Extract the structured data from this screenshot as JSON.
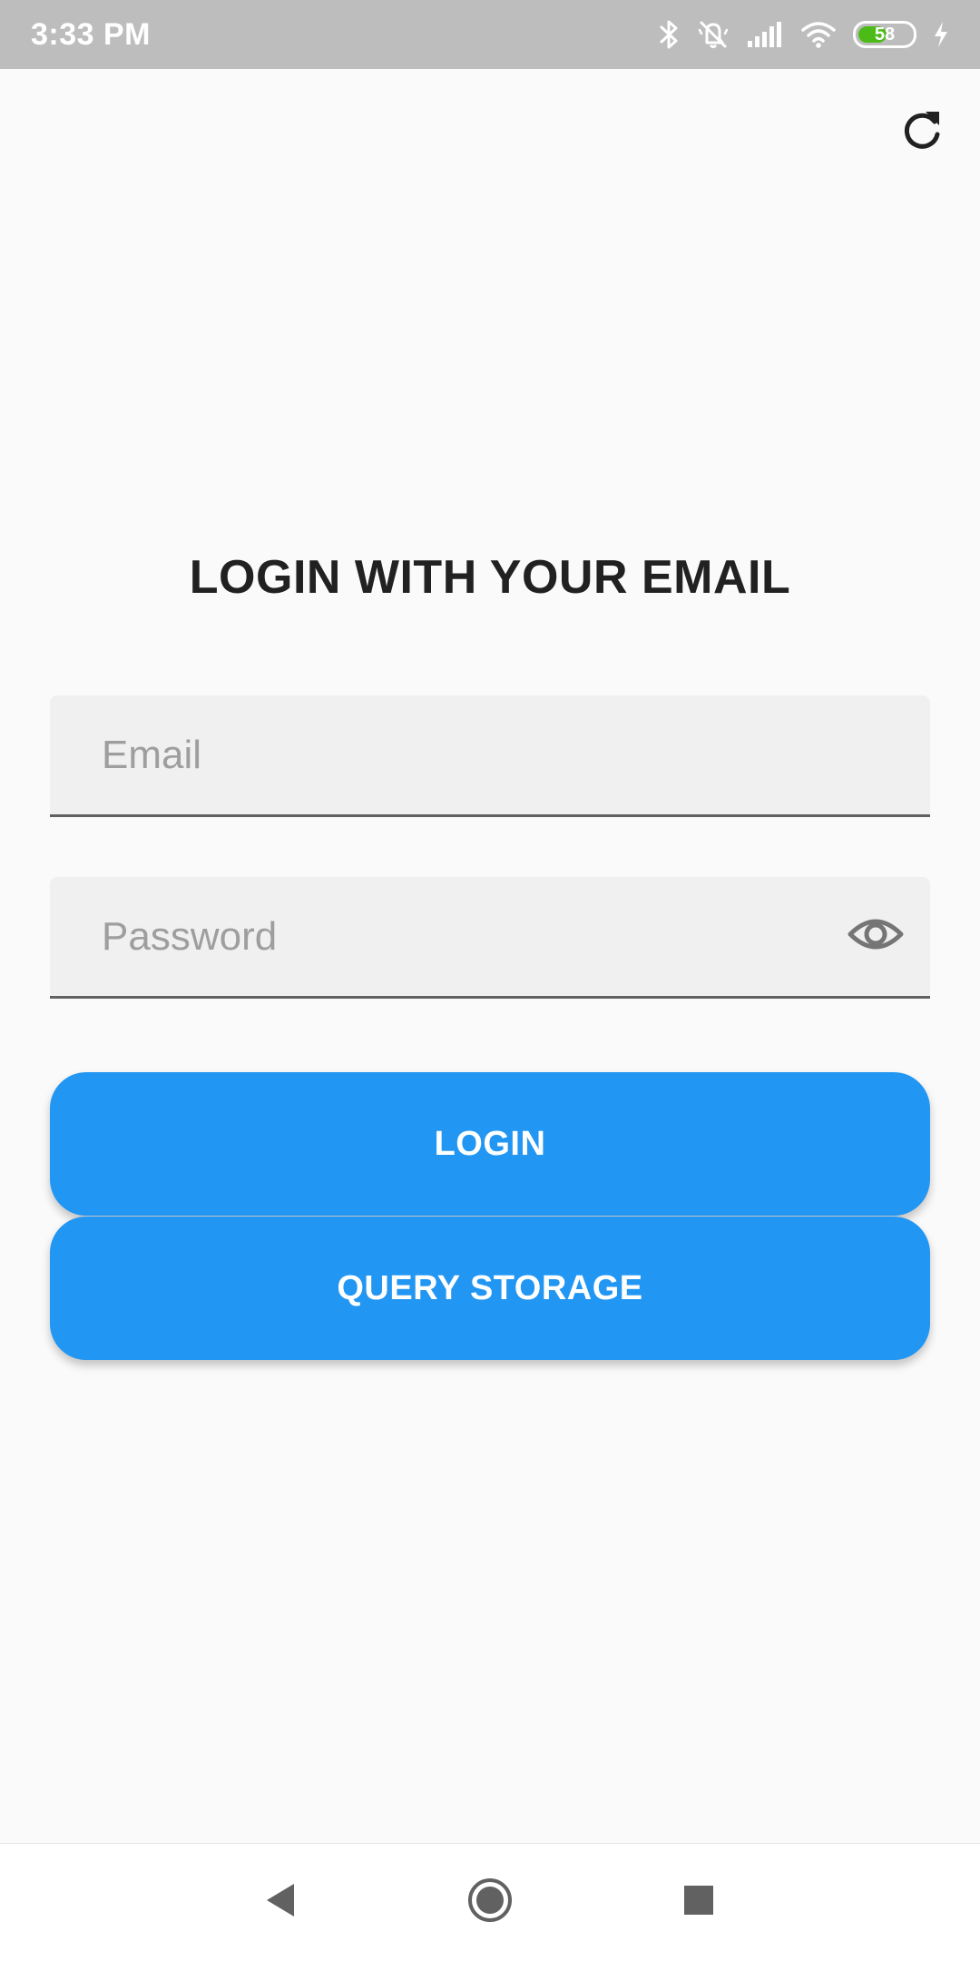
{
  "status_bar": {
    "time": "3:33 PM",
    "battery_level": "58",
    "battery_fraction": 0.58,
    "icons": [
      "bluetooth-icon",
      "vibrate-off-icon",
      "signal-icon",
      "wifi-icon",
      "battery-icon",
      "charging-icon"
    ],
    "background_color": "#bdbdbd"
  },
  "header": {
    "refresh_icon": "refresh-icon"
  },
  "login": {
    "title": "LOGIN WITH YOUR EMAIL",
    "email_placeholder": "Email",
    "email_value": "",
    "password_placeholder": "Password",
    "password_value": "",
    "password_toggle_icon": "eye-icon",
    "login_button_label": "LOGIN",
    "query_button_label": "QUERY STORAGE",
    "accent_color": "#2196f3"
  },
  "nav_bar": {
    "back_icon": "back-triangle-icon",
    "home_icon": "home-circle-icon",
    "recents_icon": "recents-square-icon"
  }
}
